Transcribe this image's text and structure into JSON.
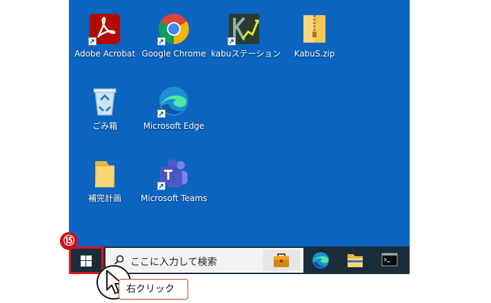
{
  "desktop_icons": [
    {
      "label": "Adobe Acrobat"
    },
    {
      "label": "Google Chrome"
    },
    {
      "label": "kabuステーション"
    },
    {
      "label": "KabuS.zip"
    },
    {
      "label": "ごみ箱"
    },
    {
      "label": "Microsoft Edge"
    },
    {
      "label": "補完計画"
    },
    {
      "label": "Microsoft Teams"
    }
  ],
  "taskbar": {
    "search_placeholder": "ここに入力して検索",
    "pinned_apps": [
      "Microsoft Store",
      "Microsoft Edge",
      "File Explorer",
      "Command Prompt"
    ]
  },
  "annotation": {
    "step_number": "⑮",
    "label": "右クリック"
  },
  "colors": {
    "desktop_bg": "#0b64c0",
    "taskbar_bg": "#1b2d3b",
    "highlight": "#e0141c"
  }
}
